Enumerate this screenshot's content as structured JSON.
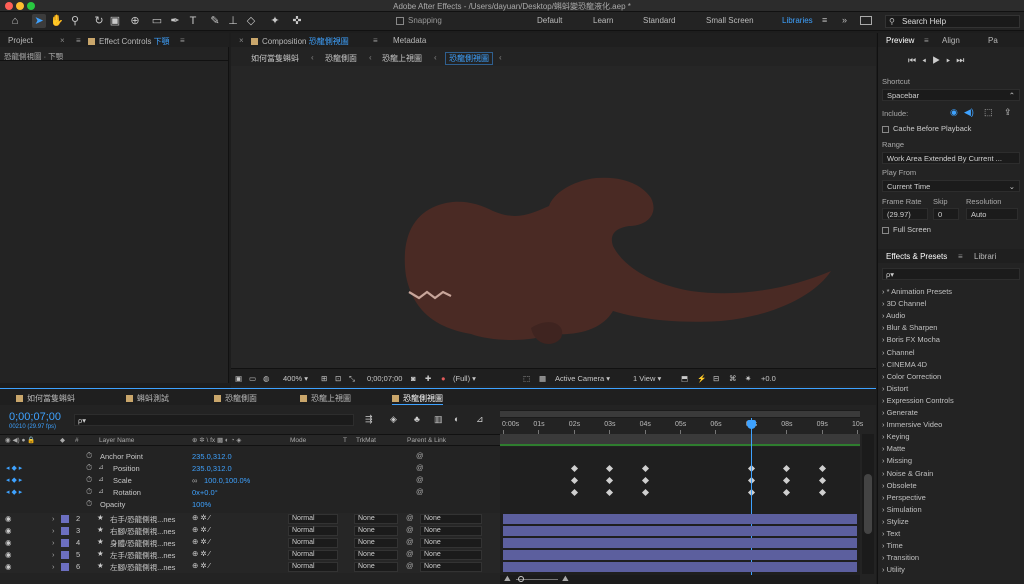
{
  "window": {
    "title": "Adobe After Effects - /Users/dayuan/Desktop/蝌蚪變恐龍液化.aep *"
  },
  "toolbar": {
    "snapping_label": "Snapping",
    "workspaces": [
      "Default",
      "Learn",
      "Standard",
      "Small Screen",
      "Libraries"
    ],
    "active_workspace": "Libraries",
    "search_placeholder": "Search Help"
  },
  "left_panel": {
    "tabs": [
      "Project",
      "Effect Controls"
    ],
    "effect_controls_target": "下顎",
    "subheader": "恐龍側視圖 · 下顎"
  },
  "composition": {
    "tab_label": "Composition",
    "tab_name": "恐龍側視圖",
    "metadata_tab": "Metadata",
    "breadcrumbs": [
      "如何當隻蝌蚪",
      "恐龍側面",
      "恐龍上視圖",
      "恐龍側視圖"
    ],
    "viewer_bar": {
      "zoom": "400%",
      "timecode": "0;00;07;00",
      "resolution": "(Full)",
      "camera": "Active Camera",
      "views": "1 View",
      "exposure": "+0.0"
    }
  },
  "right_panel": {
    "preview": {
      "tabs": [
        "Preview",
        "Align",
        "Pa"
      ],
      "shortcut_label": "Shortcut",
      "shortcut_value": "Spacebar",
      "include_label": "Include:",
      "cache_label": "Cache Before Playback",
      "range_label": "Range",
      "range_value": "Work Area Extended By Current ...",
      "play_from_label": "Play From",
      "play_from_value": "Current Time",
      "frame_rate_label": "Frame Rate",
      "skip_label": "Skip",
      "resolution_label": "Resolution",
      "frame_rate_value": "(29.97)",
      "skip_value": "0",
      "resolution_value": "Auto",
      "full_screen_label": "Full Screen"
    },
    "effects": {
      "tabs": [
        "Effects & Presets",
        "Librari"
      ],
      "search_placeholder": "ρ▾",
      "items": [
        "* Animation Presets",
        "3D Channel",
        "Audio",
        "Blur & Sharpen",
        "Boris FX Mocha",
        "Channel",
        "CINEMA 4D",
        "Color Correction",
        "Distort",
        "Expression Controls",
        "Generate",
        "Immersive Video",
        "Keying",
        "Matte",
        "Missing",
        "Noise & Grain",
        "Obsolete",
        "Perspective",
        "Simulation",
        "Stylize",
        "Text",
        "Time",
        "Transition",
        "Utility"
      ]
    }
  },
  "timeline": {
    "tabs": [
      "如何當隻蝌蚪",
      "蝌蚪測試",
      "恐龍側面",
      "恐龍上視圖",
      "恐龍側視圖"
    ],
    "active_tab": "恐龍側視圖",
    "timecode": "0;00;07;00",
    "frame_info": "00210 (29.97 fps)",
    "columns": {
      "layer_name": "Layer Name",
      "mode": "Mode",
      "t": "T",
      "trkmat": "TrkMat",
      "parent": "Parent & Link",
      "hash": "#"
    },
    "properties": [
      {
        "name": "Anchor Point",
        "value": "235.0,312.0"
      },
      {
        "name": "Position",
        "value": "235.0,312.0"
      },
      {
        "name": "Scale",
        "value": "100.0,100.0%"
      },
      {
        "name": "Rotation",
        "value": "0x+0.0°"
      },
      {
        "name": "Opacity",
        "value": "100%"
      }
    ],
    "layers": [
      {
        "num": "2",
        "name": "右手/恐龍側視...nes",
        "mode": "Normal",
        "trkmat": "None",
        "parent": "None"
      },
      {
        "num": "3",
        "name": "右腳/恐龍側視...nes",
        "mode": "Normal",
        "trkmat": "None",
        "parent": "None"
      },
      {
        "num": "4",
        "name": "身體/恐龍側視...nes",
        "mode": "Normal",
        "trkmat": "None",
        "parent": "None"
      },
      {
        "num": "5",
        "name": "左手/恐龍側視...nes",
        "mode": "Normal",
        "trkmat": "None",
        "parent": "None"
      },
      {
        "num": "6",
        "name": "左腳/恐龍側視...nes",
        "mode": "Normal",
        "trkmat": "None",
        "parent": "None"
      }
    ],
    "ruler": [
      "0:00s",
      "01s",
      "02s",
      "03s",
      "04s",
      "05s",
      "06s",
      "07s",
      "08s",
      "09s",
      "10s"
    ],
    "playhead_second": 7,
    "duration_seconds": 10,
    "keyframe_seconds": [
      2,
      3,
      4,
      7,
      8,
      9
    ]
  },
  "colors": {
    "accent": "#3ea2ff",
    "layer_bar": "#5c5f9e",
    "dino": "#4a2a24",
    "label": "#c9a66b"
  }
}
